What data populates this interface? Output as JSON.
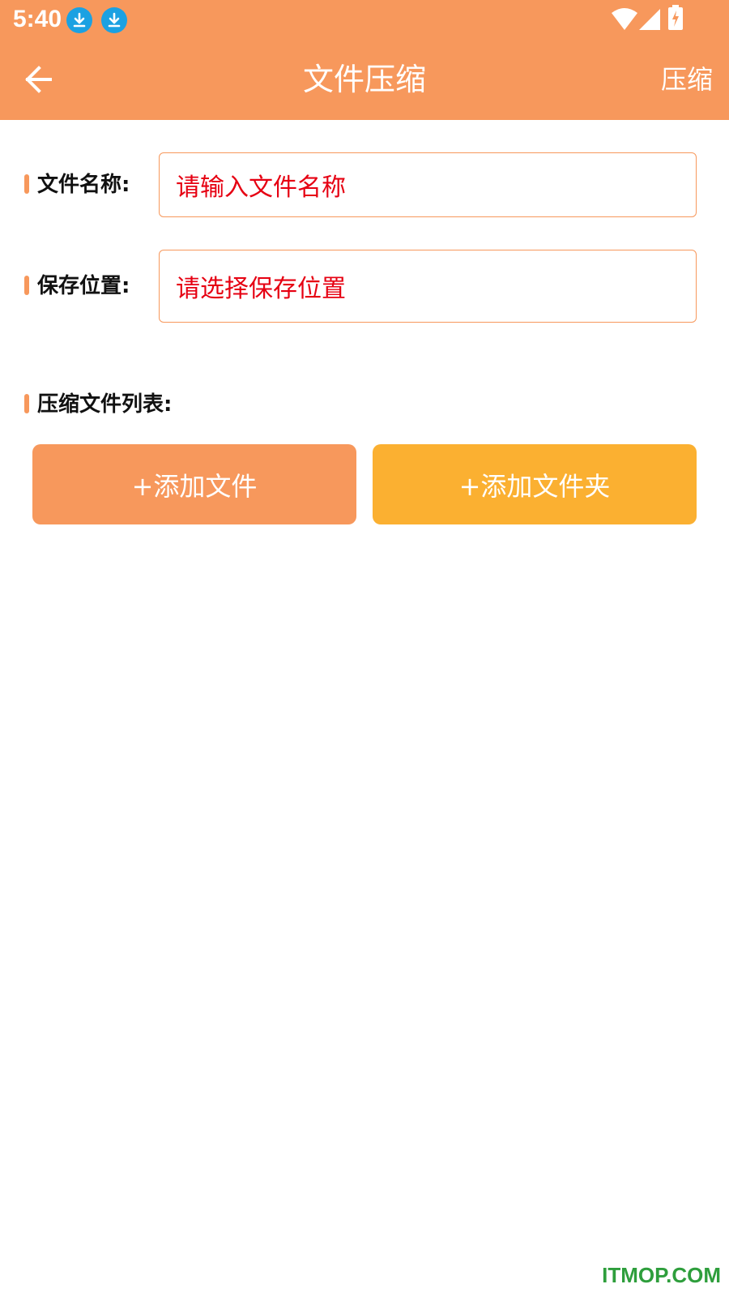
{
  "status_bar": {
    "time": "5:40",
    "notification_icons": [
      "download-icon",
      "download-icon"
    ],
    "right_icons": [
      "wifi-icon",
      "cell-signal-icon",
      "battery-charging-icon"
    ]
  },
  "app_bar": {
    "back_icon": "arrow-left-icon",
    "title": "文件压缩",
    "action_label": "压缩"
  },
  "form": {
    "file_name": {
      "label": "文件名称:",
      "value": "",
      "placeholder": "请输入文件名称"
    },
    "save_location": {
      "label": "保存位置:",
      "value": "",
      "placeholder": "请选择保存位置"
    }
  },
  "file_list": {
    "label": "压缩文件列表:",
    "add_file_label": "+添加文件",
    "add_folder_label": "+添加文件夹",
    "items": []
  },
  "watermark": "ITMOP.COM",
  "colors": {
    "primary": "#F7985C",
    "secondary": "#FBB031",
    "placeholder": "#E60012",
    "watermark": "#2E9E3C"
  }
}
